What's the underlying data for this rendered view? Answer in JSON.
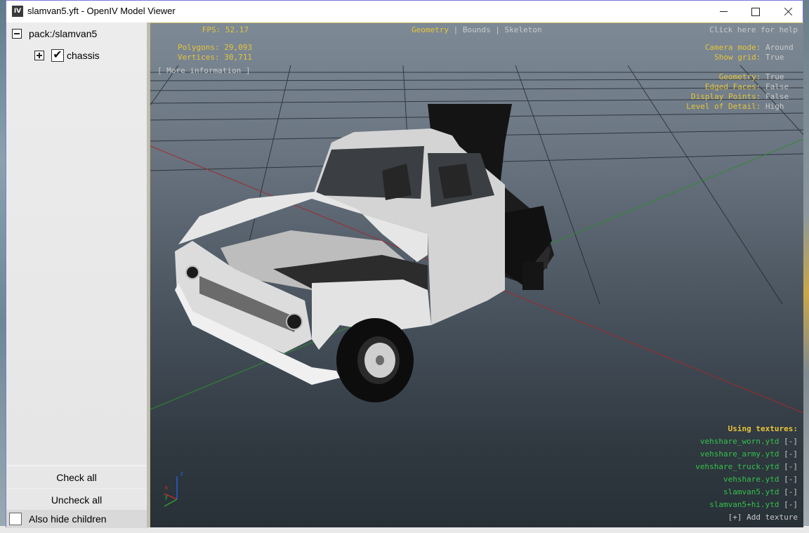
{
  "window": {
    "title": "slamvan5.yft - OpenIV Model Viewer",
    "app_icon_text": "IV"
  },
  "tree": {
    "root": "pack:/slamvan5",
    "child": "chassis",
    "child_checked_glyph": "✔"
  },
  "panel": {
    "check_all": "Check all",
    "uncheck_all": "Uncheck all",
    "hide_children": "Also hide children"
  },
  "hud": {
    "fps_label": "FPS:",
    "fps_value": "52.17",
    "polygons_label": "Polygons:",
    "polygons_value": "29,093",
    "vertices_label": "Vertices:",
    "vertices_value": "30,711",
    "more_info": "[ More information ]",
    "tabs": [
      "Geometry",
      "Bounds",
      "Skeleton"
    ],
    "tab_sep": "|",
    "help": "Click here for help",
    "settings": [
      {
        "label": "Camera mode:",
        "value": "Around"
      },
      {
        "label": "Show grid:",
        "value": "True"
      },
      {
        "label": "Geometry:",
        "value": "True"
      },
      {
        "label": "Edged Faces:",
        "value": "False"
      },
      {
        "label": "Display Points:",
        "value": "False"
      },
      {
        "label": "Level of Detail:",
        "value": "High"
      }
    ],
    "textures_header": "Using textures:",
    "textures": [
      "vehshare_worn.ytd",
      "vehshare_army.ytd",
      "vehshare_truck.ytd",
      "vehshare.ytd",
      "slamvan5.ytd",
      "slamvan5+hi.ytd"
    ],
    "remove_label": "[-]",
    "add_texture": "[+] Add texture",
    "axis": {
      "z": "z",
      "x": "x",
      "y": "y"
    }
  },
  "colors": {
    "hud_yellow": "#e6c43a",
    "hud_gray": "#c9c9c9",
    "hud_green": "#33c24a"
  }
}
